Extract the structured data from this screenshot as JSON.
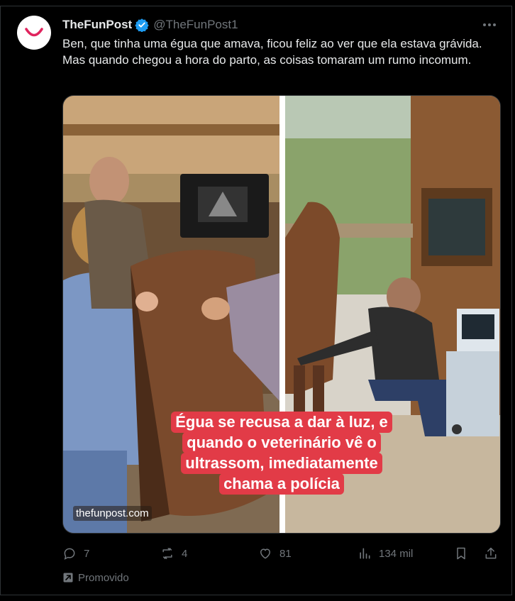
{
  "author": {
    "name": "TheFunPost",
    "handle": "@TheFunPost1"
  },
  "tweet": {
    "text": "Ben, que tinha uma égua que amava, ficou feliz ao ver que ela estava grávida. Mas quando chegou a hora do parto, as coisas tomaram um rumo incomum."
  },
  "media": {
    "caption_lines": [
      "Égua se recusa a dar à luz, e",
      "quando o veterinário vê o",
      "ultrassom, imediatamente",
      "chama a polícia"
    ],
    "watermark": "thefunpost.com"
  },
  "actions": {
    "replies": "7",
    "reposts": "4",
    "likes": "81",
    "views": "134 mil"
  },
  "promoted_label": "Promovido",
  "colors": {
    "background": "#000000",
    "text": "#e7e9ea",
    "muted": "#71767b",
    "verified": "#1d9bf0",
    "caption_bg": "#e23b47",
    "avatar_mark": "#e0245e"
  },
  "icons": [
    "avatar-smile-icon",
    "verified-badge-icon",
    "more-icon",
    "reply-icon",
    "repost-icon",
    "like-icon",
    "views-icon",
    "bookmark-icon",
    "share-icon",
    "promoted-icon"
  ]
}
